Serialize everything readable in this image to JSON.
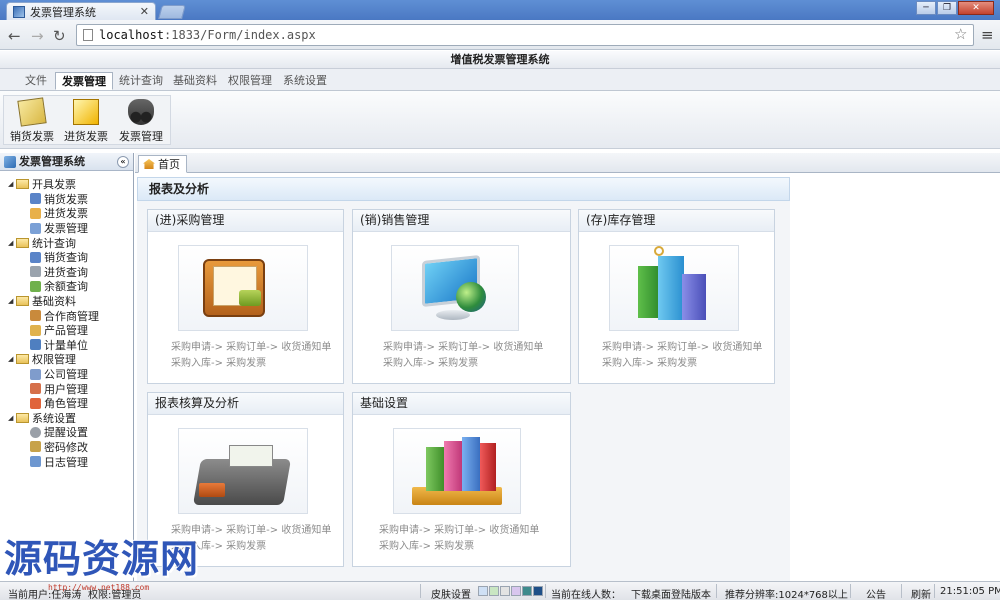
{
  "browser": {
    "tab_title": "发票管理系统",
    "url_host": "localhost",
    "url_path": ":1833/Form/index.aspx"
  },
  "app": {
    "title": "增值税发票管理系统"
  },
  "menu": {
    "items": [
      "文件",
      "发票管理",
      "统计查询",
      "基础资料",
      "权限管理",
      "系统设置"
    ],
    "active": "发票管理"
  },
  "toolbar": {
    "tools": [
      {
        "label": "销货发票",
        "icon": "sale-invoice-icon"
      },
      {
        "label": "进货发票",
        "icon": "purchase-invoice-icon"
      },
      {
        "label": "发票管理",
        "icon": "binoculars-icon"
      }
    ]
  },
  "sidebar": {
    "title": "发票管理系统",
    "groups": [
      {
        "label": "开具发票",
        "items": [
          "销货发票",
          "进货发票",
          "发票管理"
        ]
      },
      {
        "label": "统计查询",
        "items": [
          "销货查询",
          "进货查询",
          "余额查询"
        ]
      },
      {
        "label": "基础资料",
        "items": [
          "合作商管理",
          "产品管理",
          "计量单位"
        ]
      },
      {
        "label": "权限管理",
        "items": [
          "公司管理",
          "用户管理",
          "角色管理"
        ]
      },
      {
        "label": "系统设置",
        "items": [
          "提醒设置",
          "密码修改",
          "日志管理"
        ]
      }
    ]
  },
  "main": {
    "tab_home": "首页",
    "section_title": "报表及分析",
    "cards": [
      {
        "title": "(进)采购管理",
        "line1": "采购申请-> 采购订单-> 收货通知单",
        "line2": "采购入库-> 采购发票"
      },
      {
        "title": "(销)销售管理",
        "line1": "采购申请-> 采购订单-> 收货通知单",
        "line2": "采购入库-> 采购发票"
      },
      {
        "title": "(存)库存管理",
        "line1": "采购申请-> 采购订单-> 收货通知单",
        "line2": "采购入库-> 采购发票"
      },
      {
        "title": "报表核算及分析",
        "line1": "采购申请-> 采购订单-> 收货通知单",
        "line2": "采购入库-> 采购发票"
      },
      {
        "title": "基础设置",
        "line1": "采购申请-> 采购订单-> 收货通知单",
        "line2": "采购入库-> 采购发票"
      }
    ]
  },
  "status": {
    "current_user": "当前用户:任海涛",
    "role": "权限:管理员",
    "skin": "皮肤设置",
    "skin_colors": [
      "#cfe0f5",
      "#c9e6c2",
      "#e3e3e3",
      "#d8c6ee",
      "#3d8a8c",
      "#1e4f88"
    ],
    "online": "当前在线人数：",
    "download": "下载桌面登陆版本",
    "resolution": "推荐分辨率:1024*768以上",
    "notice": "公告",
    "refresh": "刷新",
    "time": "21:51:05 PM"
  },
  "watermark": {
    "text": "源码资源网",
    "url": "http://www.net188.com"
  }
}
